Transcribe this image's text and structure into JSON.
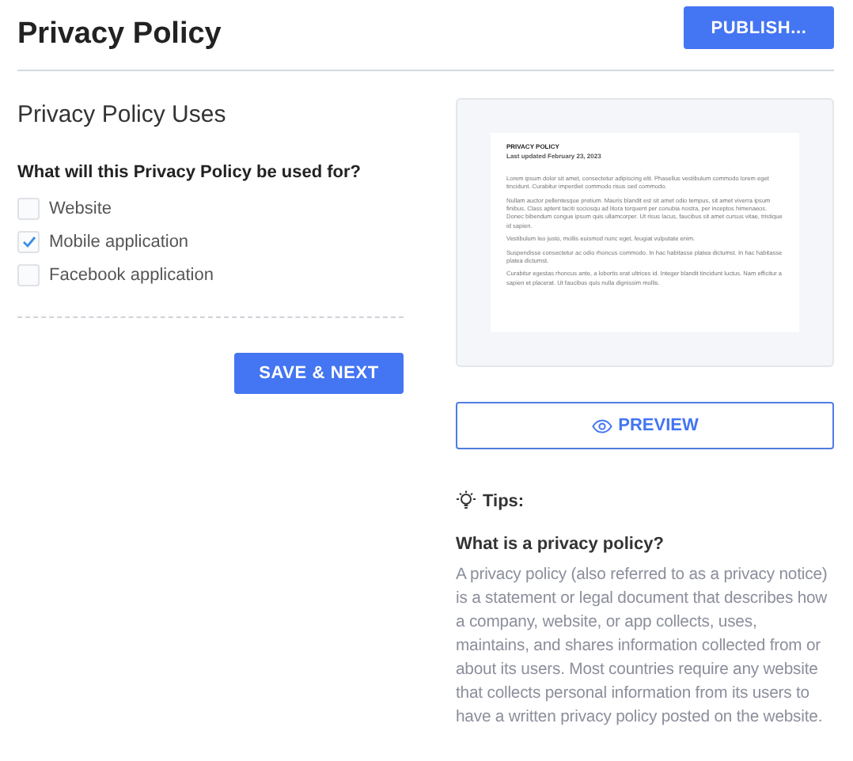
{
  "header": {
    "title": "Privacy Policy",
    "publish_button": "PUBLISH..."
  },
  "uses": {
    "heading": "Privacy Policy Uses",
    "question": "What will this Privacy Policy be used for?",
    "options": [
      {
        "label": "Website",
        "checked": false
      },
      {
        "label": "Mobile application",
        "checked": true
      },
      {
        "label": "Facebook application",
        "checked": false
      }
    ],
    "save_button": "SAVE & NEXT"
  },
  "document_preview": {
    "title": "PRIVACY POLICY",
    "updated": "Last updated February 23, 2023",
    "paragraphs": [
      "Lorem ipsum dolor sit amet, consectetur adipiscing elit. Phasellus vestibulum commodo lorem eget tincidunt. Curabitur imperdiet commodo risus sed commodo.",
      "Nullam auctor pellentesque pretium. Mauris blandit est sit amet odio tempus, sit amet viverra ipsum finibus. Class aptent taciti sociosqu ad litora torquent per conubia nostra, per inceptos himenaeos. Donec bibendum congue ipsum quis ullamcorper. Ut risus lacus, faucibus sit amet cursus vitae, tristique id sapien.",
      "Vestibulum leo justo, mollis euismod nunc eget, feugiat vulputate enim.",
      "Suspendisse consectetur ac odio rhoncus commodo. In hac habitasse platea dictumst. In hac habitasse platea dictumst.",
      "Curabitur egestas rhoncus ante, a lobortis erat ultrices id. Integer blandit tincidunt luctus. Nam efficitur a sapien et placerat. Ut faucibus quis nulla dignissim mollis."
    ],
    "preview_button": "PREVIEW"
  },
  "tips": {
    "label": "Tips:",
    "question": "What is a privacy policy?",
    "answer": "A privacy policy (also referred to as a privacy notice) is a statement or legal document that describes how a company, website, or app collects, uses, maintains, and shares information collected from or about its users. Most countries require any website that collects personal information from its users to have a written privacy policy posted on the website."
  }
}
